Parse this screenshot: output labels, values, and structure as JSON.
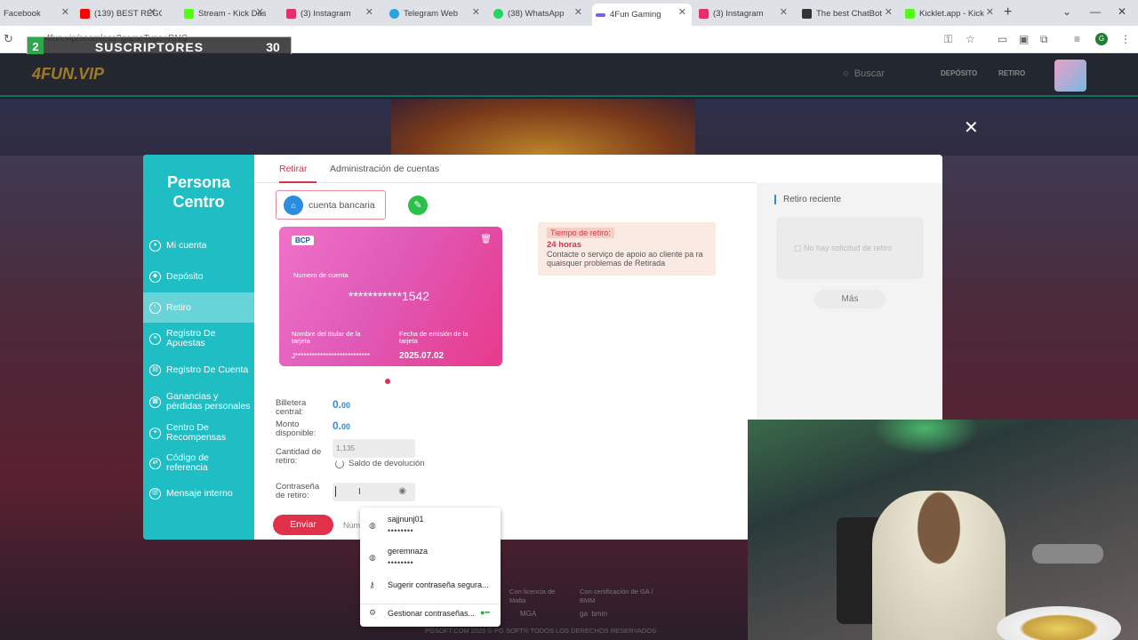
{
  "browser": {
    "tabs": [
      {
        "label": "Facebook",
        "color": "#1877f2"
      },
      {
        "label": "(139) BEST REGGA",
        "color": "#ff0000"
      },
      {
        "label": "Stream - Kick Das",
        "color": "#53fc18"
      },
      {
        "label": "(3) Instagram",
        "color": "#e1306c"
      },
      {
        "label": "Telegram Web",
        "color": "#2aa3e0"
      },
      {
        "label": "(38) WhatsApp",
        "color": "#25d366"
      },
      {
        "label": "4Fun Gaming",
        "color": "#7a5af8"
      },
      {
        "label": "(3) Instagram",
        "color": "#e1306c"
      },
      {
        "label": "The best ChatBot",
        "color": "#333333"
      },
      {
        "label": "Kicklet.app - Kick",
        "color": "#53fc18"
      }
    ],
    "url": "4fun.vip/seamless?gameType=RNG"
  },
  "overlay": {
    "number": "2",
    "label": "SUSCRIPTORES",
    "count": "30"
  },
  "site": {
    "logo": "4FUN.VIP",
    "search_placeholder": "Buscar",
    "deposit_label": "DEPÓSITO",
    "withdraw_label": "RETIRO"
  },
  "modal": {
    "title_line1": "Persona",
    "title_line2": "Centro",
    "nav": [
      {
        "label": "Mi cuenta"
      },
      {
        "label": "Depósito"
      },
      {
        "label": "Retiro"
      },
      {
        "label": "Registro De Apuestas"
      },
      {
        "label": "Registro De Cuenta"
      },
      {
        "label": "Ganancias y pérdidas personales"
      },
      {
        "label": "Centro De Recompensas"
      },
      {
        "label": "Código de referencia"
      },
      {
        "label": "Mensaje interno"
      }
    ],
    "tabs": [
      "Retirar",
      "Administración de cuentas"
    ],
    "bank_button": "cuenta bancaria",
    "card": {
      "bank": "BCP",
      "number_label": "Numero de cuenta",
      "number": "***********1542",
      "holder_label": "Nombre del titular de la tarjeta",
      "holder": "J***************************",
      "date_label": "Fecha de emisión de la tarjeta",
      "date": "2025.07.02"
    },
    "notice": {
      "title": "Tiempo de retiro:",
      "value": "24 horas",
      "desc": "Contacte o serviço de apoio ao cliente pa ra quaisquer problemas de Retirada"
    },
    "fields": {
      "wallet_label": "Billetera central:",
      "wallet_int": "0.",
      "wallet_dec": "00",
      "available_label": "Monto disponible:",
      "available_int": "0.",
      "available_dec": "00",
      "amount_label": "Cantidad de retiro:",
      "amount_placeholder": "1,135",
      "refund_label": "Saldo de devolución",
      "password_label": "Contraseña de retiro:"
    },
    "send_label": "Enviar",
    "number_label": "Núm",
    "recent": {
      "title": "Retiro reciente",
      "empty": "No hay solicitud de retiro",
      "more": "Más"
    }
  },
  "autofill": {
    "entries": [
      {
        "user": "sajjnunj01",
        "mask": "••••••••"
      },
      {
        "user": "geremnaza",
        "mask": "••••••••"
      }
    ],
    "suggest": "Sugerir contraseña segura...",
    "manage": "Gestionar contraseñas..."
  },
  "footer": {
    "license_a": "Con licencia de",
    "license_b": "Malta",
    "cert_a": "Con certificación de GA /",
    "cert_b": "BMM",
    "logo_mga": "MGA",
    "logo_ga": "ga",
    "logo_bmm": "bmm",
    "copyright": "PGSOFT.COM 2025 © PG SOFT® TODOS LOS DERECHOS RESERVADOS"
  }
}
